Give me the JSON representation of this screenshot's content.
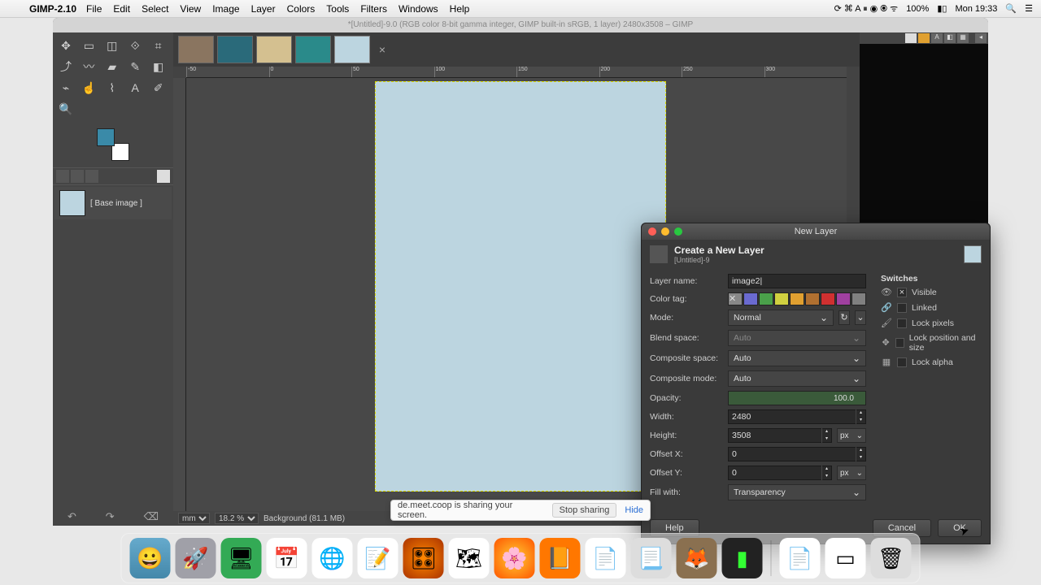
{
  "menubar": {
    "app": "GIMP-2.10",
    "items": [
      "File",
      "Edit",
      "Select",
      "View",
      "Image",
      "Layer",
      "Colors",
      "Tools",
      "Filters",
      "Windows",
      "Help"
    ],
    "right": {
      "battery": "100%",
      "clock": "Mon 19:33"
    }
  },
  "window": {
    "title": "*[Untitled]-9.0 (RGB color 8-bit gamma integer, GIMP built-in sRGB, 1 layer) 2480x3508 – GIMP"
  },
  "layers": {
    "entry": "[ Base image ]"
  },
  "statusbar": {
    "unit": "mm",
    "zoom": "18.2 %",
    "info": "Background (81.1 MB)"
  },
  "dialog": {
    "title": "New Layer",
    "heading": "Create a New Layer",
    "sub": "[Untitled]-9",
    "labels": {
      "layer_name": "Layer name:",
      "color_tag": "Color tag:",
      "mode": "Mode:",
      "blend_space": "Blend space:",
      "composite_space": "Composite space:",
      "composite_mode": "Composite mode:",
      "opacity": "Opacity:",
      "width": "Width:",
      "height": "Height:",
      "offset_x": "Offset X:",
      "offset_y": "Offset Y:",
      "fill_with": "Fill with:"
    },
    "values": {
      "layer_name": "image2|",
      "mode": "Normal",
      "blend_space": "Auto",
      "composite_space": "Auto",
      "composite_mode": "Auto",
      "opacity": "100.0",
      "width": "2480",
      "height": "3508",
      "offset_x": "0",
      "offset_y": "0",
      "unit": "px",
      "fill_with": "Transparency"
    },
    "switches": {
      "heading": "Switches",
      "visible": "Visible",
      "linked": "Linked",
      "lock_pixels": "Lock pixels",
      "lock_pos": "Lock position and size",
      "lock_alpha": "Lock alpha"
    },
    "buttons": {
      "help": "Help",
      "cancel": "Cancel",
      "ok": "OK"
    },
    "color_tags": [
      "#888888",
      "#6a6ad0",
      "#4aa04a",
      "#d0d040",
      "#e0a030",
      "#b07030",
      "#d03030",
      "#a040a0",
      "#808080"
    ]
  },
  "share": {
    "msg": "de.meet.coop is sharing your screen.",
    "stop": "Stop sharing",
    "hide": "Hide"
  }
}
